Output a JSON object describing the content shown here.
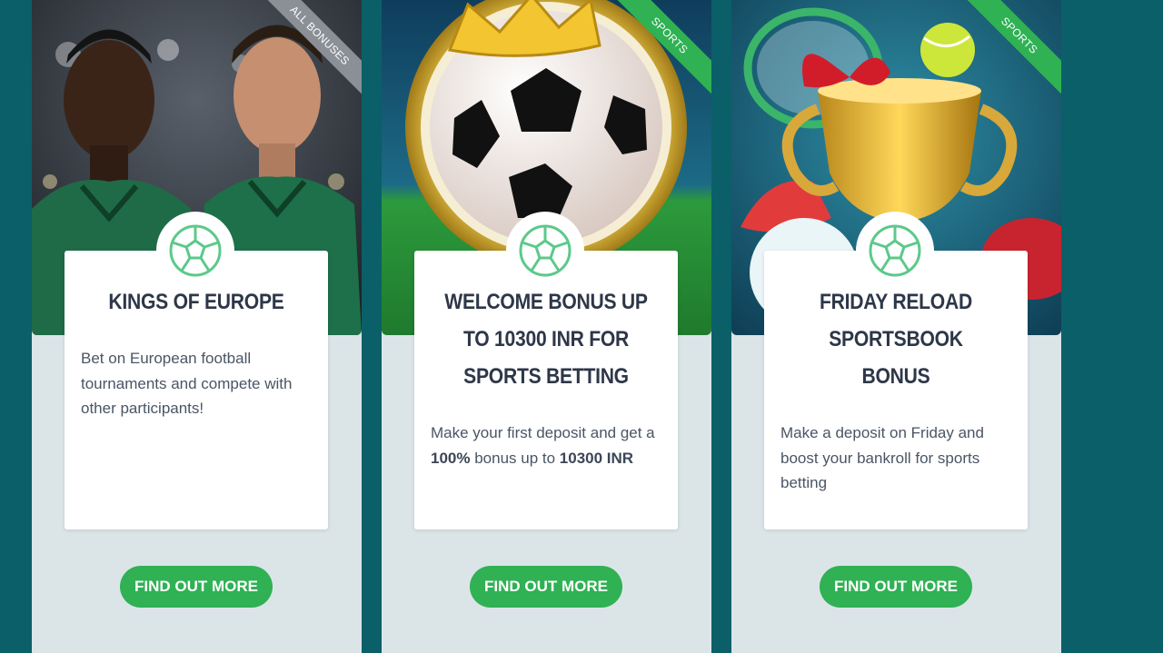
{
  "cards": [
    {
      "ribbon": "ALL BONUSES",
      "ribbon_color": "#8b9096",
      "title": "KINGS OF EUROPE",
      "description": "Bet on European football tournaments and compete with other participants!",
      "button": "FIND OUT MORE",
      "image": "two-football-players"
    },
    {
      "ribbon": "SPORTS",
      "ribbon_color": "#2fb154",
      "title": "WELCOME BONUS UP TO 10300 INR FOR SPORTS BETTING",
      "description_parts": [
        "Make your first deposit and get a ",
        "100%",
        " bonus up to ",
        "10300 INR"
      ],
      "button": "FIND OUT MORE",
      "image": "crowned-football-in-stadium"
    },
    {
      "ribbon": "SPORTS",
      "ribbon_color": "#2fb154",
      "title": "FRIDAY RELOAD SPORTSBOOK BONUS",
      "description": "Make a deposit on Friday and boost your bankroll for sports betting",
      "button": "FIND OUT MORE",
      "image": "trophy-with-sports-equipment"
    }
  ],
  "colors": {
    "page_background": "#0b5f68",
    "card_background": "#dbe5e8",
    "accent_green": "#2fb154",
    "title_text": "#2d3748",
    "icon_green": "#5cc98a"
  },
  "icons": {
    "badge": "football-icon"
  }
}
